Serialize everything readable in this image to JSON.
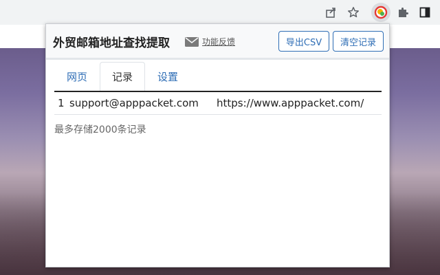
{
  "browser": {
    "icons": [
      "share-icon",
      "bookmark-star-icon",
      "extension-active-icon",
      "puzzle-extensions-icon",
      "sidebar-icon"
    ]
  },
  "popup": {
    "title": "外贸邮箱地址查找提取",
    "feedback_label": "功能反馈",
    "export_button": "导出CSV",
    "clear_button": "清空记录",
    "tabs": [
      {
        "label": "网页",
        "active": false
      },
      {
        "label": "记录",
        "active": true
      },
      {
        "label": "设置",
        "active": false
      }
    ],
    "records": [
      {
        "index": "1",
        "email": "support@apppacket.com",
        "url": "https://www.apppacket.com/"
      }
    ],
    "note": "最多存储2000条记录"
  },
  "colors": {
    "accent": "#2e6db5",
    "header_bg": "#f8f9fa",
    "toolbar_bg": "#f1f3f4"
  }
}
